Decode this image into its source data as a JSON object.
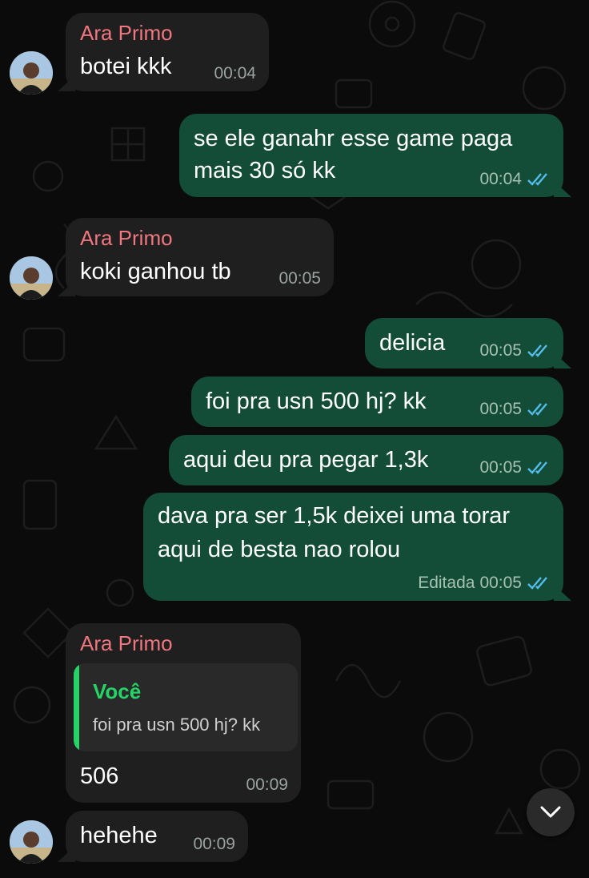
{
  "chat": {
    "contact_name": "Ara Primo",
    "colors": {
      "incoming_bubble": "#1f1f1f",
      "outgoing_bubble": "#144d37",
      "sender_name": "#f0767f",
      "read_ticks": "#53bdeb",
      "quote_accent": "#25d366"
    },
    "messages": [
      {
        "direction": "in",
        "sender": "Ara Primo",
        "text": "botei kkk",
        "time": "00:04"
      },
      {
        "direction": "out",
        "lines": [
          "se ele ganahr esse game paga",
          "mais 30 só kk"
        ],
        "time": "00:04",
        "status": "read"
      },
      {
        "direction": "in",
        "sender": "Ara Primo",
        "text": "koki ganhou tb",
        "time": "00:05"
      },
      {
        "direction": "out",
        "text": "delicia",
        "time": "00:05",
        "status": "read"
      },
      {
        "direction": "out",
        "text": "foi pra usn 500 hj? kk",
        "time": "00:05",
        "status": "read"
      },
      {
        "direction": "out",
        "text": "aqui deu pra pegar 1,3k",
        "time": "00:05",
        "status": "read"
      },
      {
        "direction": "out",
        "lines": [
          "dava pra ser 1,5k deixei uma torar",
          "aqui de besta nao rolou"
        ],
        "edited_label": "Editada",
        "time": "00:05",
        "status": "read"
      },
      {
        "direction": "in",
        "sender": "Ara Primo",
        "reply": {
          "author": "Você",
          "text": "foi pra usn 500 hj? kk"
        },
        "text": "506",
        "time": "00:09"
      },
      {
        "direction": "in",
        "text": "hehehe",
        "time": "00:09"
      }
    ]
  },
  "scroll_button": {
    "icon": "chevron-down-icon"
  }
}
